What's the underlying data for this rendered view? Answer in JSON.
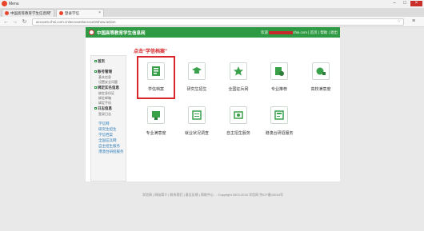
{
  "window": {
    "title": "Menu"
  },
  "tabs": [
    {
      "label": "中国高等教育学生信息网"
    },
    {
      "label": "登录学信"
    }
  ],
  "address_bar": {
    "url": "account.chsi.com.cn/account/account!show.action"
  },
  "site": {
    "title": "中国高等教育学生信息网",
    "user_prefix": "欢迎",
    "user_suffix": "chsi.com",
    "user_links": [
      "首页",
      "帮助",
      "退出"
    ],
    "annotation": "点击“学信档案”",
    "sidebar": {
      "home": "首页",
      "account": "账号管理",
      "account_subs": [
        "基本信息",
        "设置安全问题"
      ],
      "binding": "绑定实名信息",
      "binding_subs": [
        "绑定身份证",
        "绑定邮箱",
        "绑定手机"
      ],
      "log": "日志信息",
      "log_subs": [
        "登录日志"
      ],
      "links": [
        "学信网",
        "研究生招生",
        "学信档案",
        "全国征兵网",
        "自主招生服务",
        "港澳台研招服务"
      ]
    },
    "tiles": [
      {
        "label": "学信档案",
        "icon": "archive-icon"
      },
      {
        "label": "研究生招生",
        "icon": "graduation-cap-icon"
      },
      {
        "label": "全国征兵网",
        "icon": "star-icon"
      },
      {
        "label": "专业推荐",
        "icon": "recommend-icon"
      },
      {
        "label": "高校满意度",
        "icon": "satisfaction-icon"
      },
      {
        "label": "专业满意度",
        "icon": "major-satisfaction-icon"
      },
      {
        "label": "就业状况调查",
        "icon": "survey-icon"
      },
      {
        "label": "自主招生服务",
        "icon": "self-enroll-icon"
      },
      {
        "label": "港澳台研招服务",
        "icon": "hmt-icon"
      }
    ],
    "footer": "学信网 | 网站简介 | 联系我们 | 意见反馈 | 帮助中心 ... Copyright 2003-2016 学信网 京ICP备10044号"
  },
  "colors": {
    "brand_green": "#2e9a43",
    "annotation_red": "#d8262a",
    "link_blue": "#2f7db8"
  }
}
